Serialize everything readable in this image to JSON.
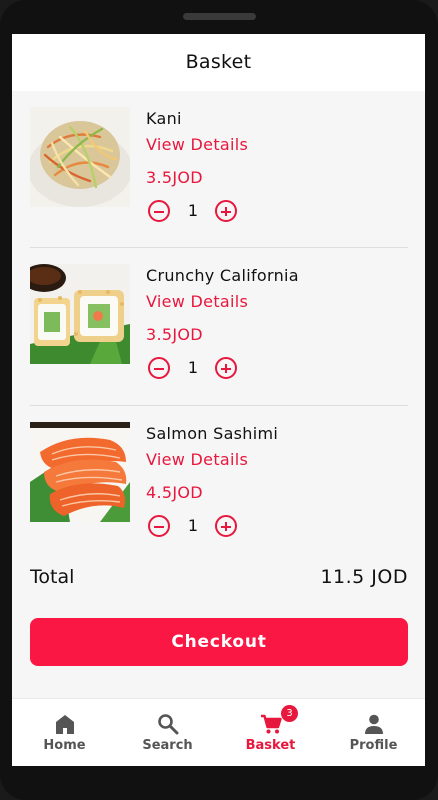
{
  "header": {
    "title": "Basket"
  },
  "items": [
    {
      "name": "Kani",
      "details_label": "View Details",
      "price": "3.5JOD",
      "quantity": "1",
      "image": "kani-salad"
    },
    {
      "name": "Crunchy California",
      "details_label": "View Details",
      "price": "3.5JOD",
      "quantity": "1",
      "image": "california-roll"
    },
    {
      "name": "Salmon Sashimi",
      "details_label": "View Details",
      "price": "4.5JOD",
      "quantity": "1",
      "image": "salmon-sashimi"
    }
  ],
  "summary": {
    "total_label": "Total",
    "total_value": "11.5 JOD"
  },
  "checkout": {
    "label": "Checkout"
  },
  "nav": {
    "items": [
      {
        "label": "Home",
        "icon": "home-icon",
        "active": false
      },
      {
        "label": "Search",
        "icon": "search-icon",
        "active": false
      },
      {
        "label": "Basket",
        "icon": "cart-icon",
        "active": true,
        "badge": "3"
      },
      {
        "label": "Profile",
        "icon": "person-icon",
        "active": false
      }
    ]
  },
  "colors": {
    "accent": "#e8173d",
    "button": "#fa1744",
    "background": "#f6f6f6"
  }
}
